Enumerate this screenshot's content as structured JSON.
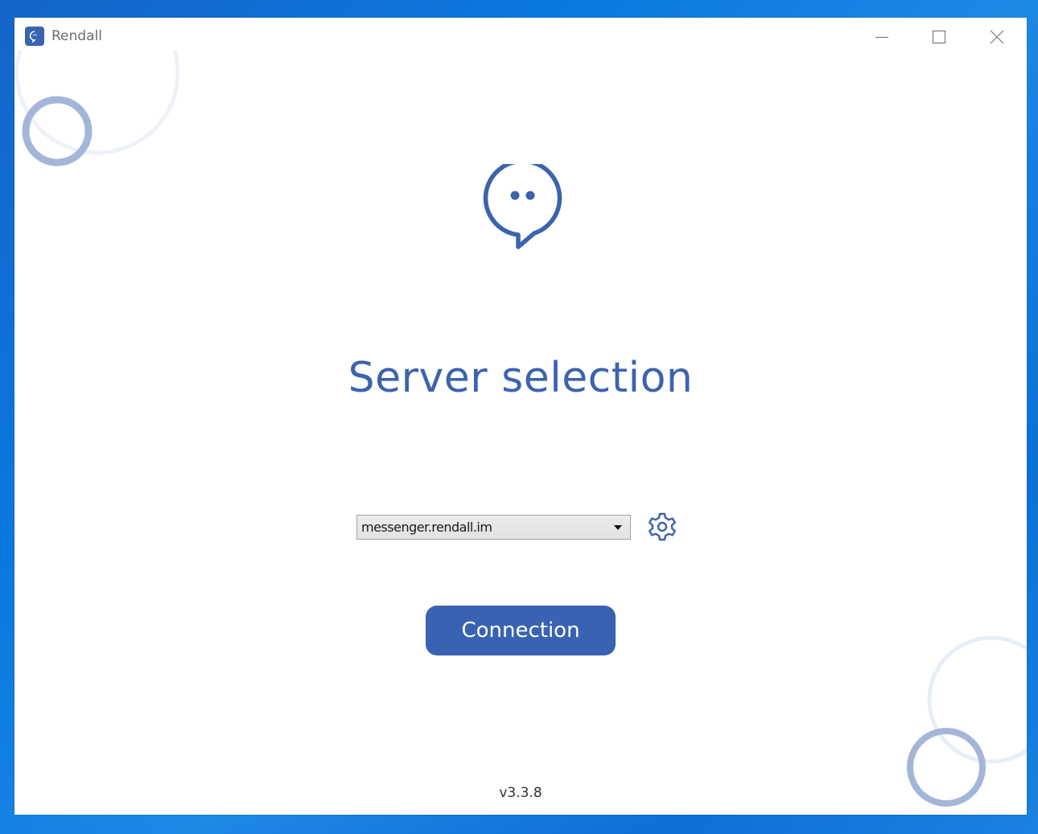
{
  "window": {
    "title": "Rendall",
    "controls": {
      "minimize_icon": "minimize-icon",
      "maximize_icon": "maximize-icon",
      "close_icon": "close-icon"
    }
  },
  "main": {
    "logo_icon": "chat-bubble-icon",
    "heading": "Server selection",
    "server_select": {
      "selected_value": "messenger.rendall.im"
    },
    "settings_icon": "gear-icon",
    "connect_label": "Connection",
    "version": "v3.3.8"
  },
  "colors": {
    "accent": "#3c63ad",
    "button": "#3a62b2",
    "deco_light": "#e8eef7",
    "deco_dark": "#9db0d4"
  }
}
